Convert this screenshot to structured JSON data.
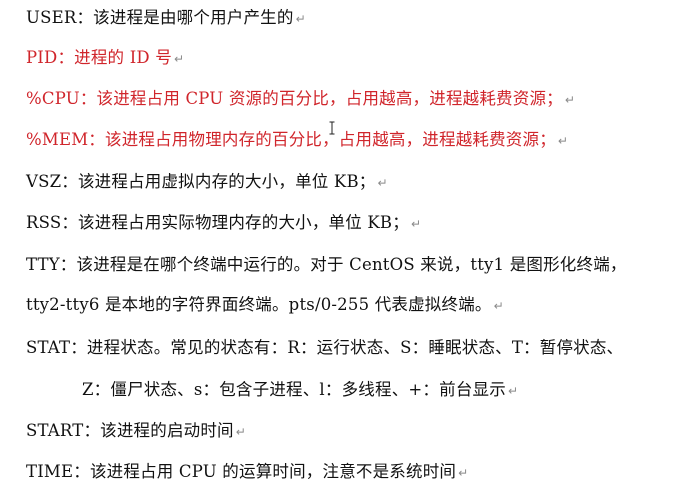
{
  "colors": {
    "text": "#111111",
    "red": "#d0252b",
    "mark": "#8a8a8a"
  },
  "paragraph_mark": "↵",
  "lines": [
    {
      "text": "USER：该进程是由哪个用户产生的",
      "mark": true
    },
    {
      "text": "PID：进程的 ID 号",
      "mark": true
    },
    {
      "text": "%CPU：该进程占用 CPU 资源的百分比，占用越高，进程越耗费资源；",
      "mark": true
    },
    {
      "text": "%MEM：该进程占用物理内存的百分比，占用越高，进程越耗费资源；",
      "mark": true
    },
    {
      "text": "VSZ：该进程占用虚拟内存的大小，单位 KB；",
      "mark": true
    },
    {
      "text": "RSS：该进程占用实际物理内存的大小，单位 KB；",
      "mark": true
    },
    {
      "text": "TTY：该进程是在哪个终端中运行的。对于 CentOS 来说，tty1 是图形化终端，",
      "mark": false
    },
    {
      "text": "tty2-tty6 是本地的字符界面终端。pts/0-255 代表虚拟终端。",
      "mark": true
    },
    {
      "text": "STAT：进程状态。常见的状态有：R：运行状态、S：睡眠状态、T：暂停状态、",
      "mark": false
    },
    {
      "text": "Z：僵尸状态、s：包含子进程、l：多线程、+：前台显示",
      "mark": true
    },
    {
      "text": "START：该进程的启动时间",
      "mark": true
    },
    {
      "text": "TIME：该进程占用 CPU 的运算时间，注意不是系统时间",
      "mark": true
    }
  ]
}
